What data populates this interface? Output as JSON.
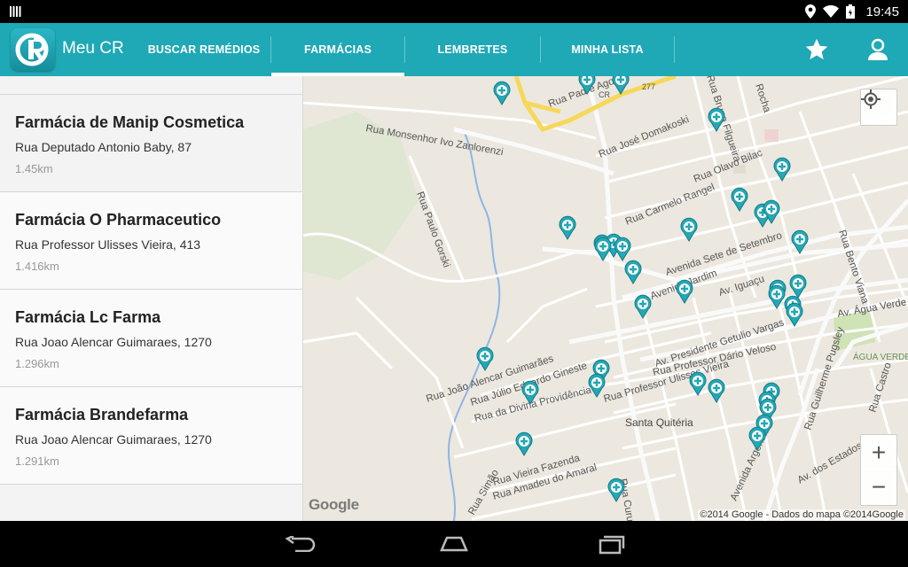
{
  "status_bar": {
    "time": "19:45"
  },
  "app": {
    "title": "Meu CR"
  },
  "tabs": [
    {
      "label": "BUSCAR REMÉDIOS",
      "active": false
    },
    {
      "label": "FARMÁCIAS",
      "active": true
    },
    {
      "label": "LEMBRETES",
      "active": false
    },
    {
      "label": "MINHA LISTA",
      "active": false
    }
  ],
  "accent_color": "#1fa8b6",
  "pharmacies": [
    {
      "name": "Farmácia de Manip Cosmetica",
      "address": "Rua Deputado Antonio Baby, 87",
      "distance": "1.45km"
    },
    {
      "name": "Farmácia O Pharmaceutico",
      "address": "Rua Professor Ulisses Vieira, 413",
      "distance": "1.416km"
    },
    {
      "name": "Farmácia Lc Farma",
      "address": "Rua Joao Alencar Guimaraes, 1270",
      "distance": "1.296km"
    },
    {
      "name": "Farmácia Brandefarma",
      "address": "Rua Joao Alencar Guimaraes, 1270",
      "distance": "1.291km"
    }
  ],
  "map": {
    "street_labels": {
      "padre": "Rua Padre Ago",
      "cr": "CR",
      "br277": "277",
      "monsenhor": "Rua Monsenhor Ivo Zanlorenzi",
      "domakoski": "Rua José Domakoski",
      "bruno": "Rua Bruno Filgueira",
      "rocha": "Rocha",
      "bilac": "Rua Olavo Bilac",
      "gorski": "Rua Paulo Gorski",
      "rangel": "Rua Carmelo Rangel",
      "setembro": "Avenida Sete de Setembro",
      "jardim": "Avenida Jardim",
      "iguacu": "Av. Iguaçu",
      "bento": "Rua Bento Viana",
      "aguaverde": "Av. Água Verde",
      "getulio": "Av. Presidente Getulio Vargas",
      "pugsley": "Rua Guilherme Pugsley",
      "aguaverde_area": "ÁGUA VERDE",
      "alencar": "Rua João Alencar Guimarães",
      "gineste": "Rua Júlio Eduardo Gineste",
      "veloso": "Rua Professor Dário Veloso",
      "divina": "Rua da Divina Providência",
      "ulisses": "Rua Professor Ulisses Vieira",
      "castro": "Rua Castro",
      "santa": "Santa Quitéria",
      "argentina": "Avenida Argentina",
      "estados": "Av. dos Estados",
      "fazenda": "Rua Vieira Fazenda",
      "amadeu": "Rua Amadeu do Amaral",
      "curupaiti": "Rua Curupaiti",
      "simao": "Rua Simão"
    },
    "logo": "Google",
    "attribution": "©2014 Google - Dados do mapa ©2014Google",
    "zoom_in": "+",
    "zoom_out": "−"
  }
}
